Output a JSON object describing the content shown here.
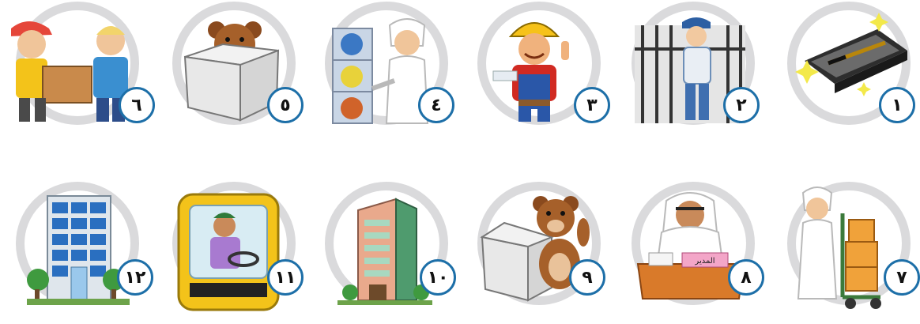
{
  "items": [
    {
      "number": "١",
      "picture": "pen-in-box-icon"
    },
    {
      "number": "٢",
      "picture": "security-guard-icon"
    },
    {
      "number": "٣",
      "picture": "construction-worker-icon"
    },
    {
      "number": "٤",
      "picture": "boy-with-shelves-icon"
    },
    {
      "number": "٥",
      "picture": "bear-in-box-icon"
    },
    {
      "number": "٦",
      "picture": "boys-with-package-icon"
    },
    {
      "number": "٧",
      "picture": "boy-with-cart-icon"
    },
    {
      "number": "٨",
      "picture": "manager-at-desk-icon"
    },
    {
      "number": "٩",
      "picture": "bear-out-of-box-icon"
    },
    {
      "number": "١٠",
      "picture": "tower-building-icon"
    },
    {
      "number": "١١",
      "picture": "bus-driver-icon"
    },
    {
      "number": "١٢",
      "picture": "office-building-icon"
    }
  ],
  "desk_sign": "المدير",
  "colors": {
    "ring": "#dadadc",
    "badge_border": "#1d6fa8"
  }
}
